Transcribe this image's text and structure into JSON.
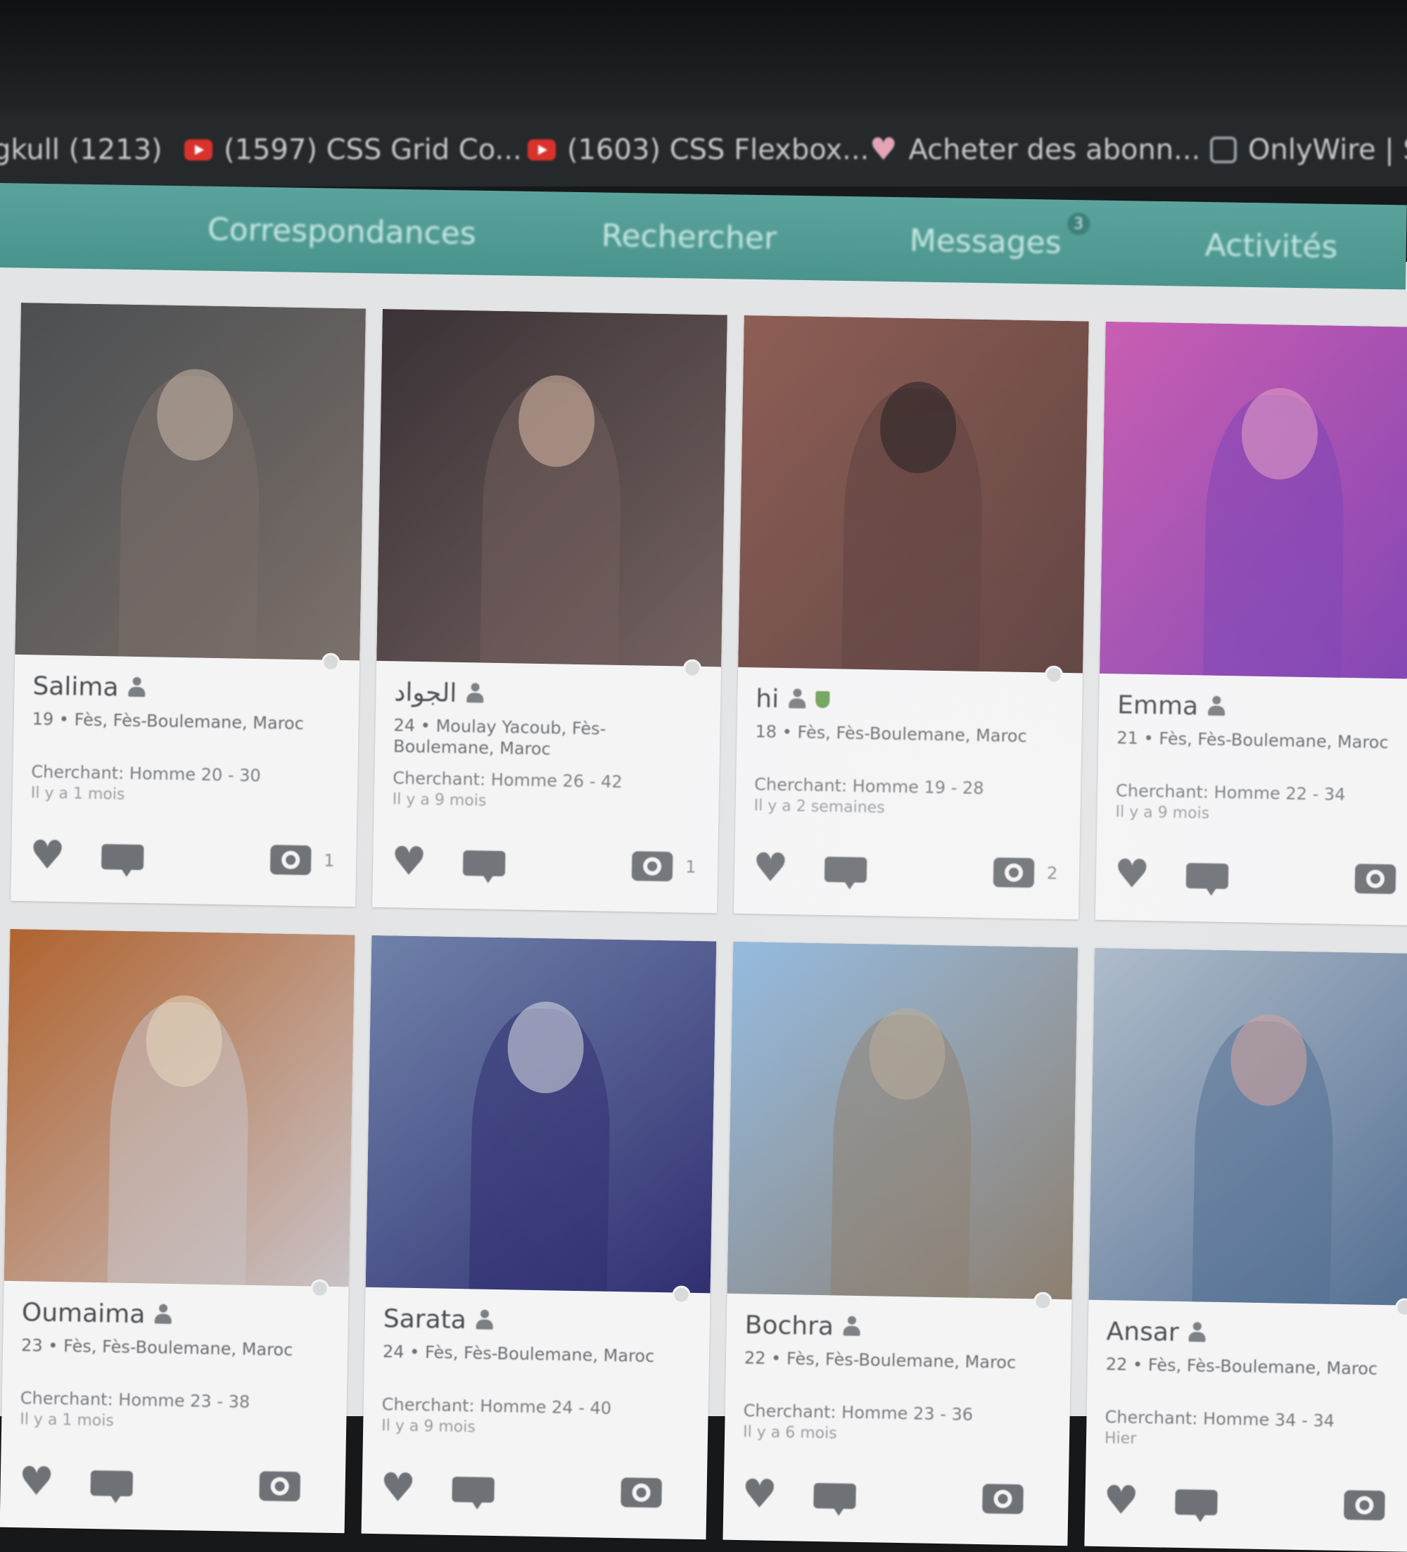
{
  "bookmarks": [
    {
      "label": "gkull (1213)",
      "icon": "bookmark-icon"
    },
    {
      "label": "(1597) CSS Grid Co...",
      "icon": "youtube-icon"
    },
    {
      "label": "(1603) CSS Flexbox...",
      "icon": "youtube-icon"
    },
    {
      "label": "Acheter des abonn...",
      "icon": "heart-icon"
    },
    {
      "label": "OnlyWire | S",
      "icon": "globe-icon"
    }
  ],
  "nav": {
    "items": [
      {
        "label": "Correspondances"
      },
      {
        "label": "Rechercher"
      },
      {
        "label": "Messages",
        "badge": "3"
      },
      {
        "label": "Activités"
      }
    ],
    "colors": {
      "bar": "#4f9a93",
      "text": "#c7e8e3"
    }
  },
  "profiles": [
    {
      "name": "Salima",
      "location": "19 • Fès, Fès-Boulemane, Maroc",
      "seeking": "Cherchant: Homme 20 - 30",
      "ago": "Il y a 1 mois",
      "photos": "1",
      "verified": false,
      "tones": [
        "#4b4f52",
        "#7a6e68",
        "#c9b7a8"
      ]
    },
    {
      "name": "الجواد",
      "location": "24 • Moulay Yacoub, Fès-Boulemane, Maroc",
      "seeking": "Cherchant: Homme 26 - 42",
      "ago": "Il y a 9 mois",
      "photos": "1",
      "verified": false,
      "tones": [
        "#3a3236",
        "#6d5a58",
        "#d8b8a6"
      ]
    },
    {
      "name": "hi",
      "location": "18 • Fès, Fès-Boulemane, Maroc",
      "seeking": "Cherchant: Homme 19 - 28",
      "ago": "Il y a 2 semaines",
      "photos": "2",
      "verified": true,
      "tones": [
        "#8c5b52",
        "#5a3c3a",
        "#1f1c1e"
      ]
    },
    {
      "name": "Emma",
      "location": "21 • Fès, Fès-Boulemane, Maroc",
      "seeking": "Cherchant: Homme 22 - 34",
      "ago": "Il y a 9 mois",
      "photos": "",
      "verified": false,
      "tones": [
        "#c85bb0",
        "#7c3fb2",
        "#e6a1c4"
      ]
    },
    {
      "name": "Oumaima",
      "location": "23 • Fès, Fès-Boulemane, Maroc",
      "seeking": "Cherchant: Homme 23 - 38",
      "ago": "Il y a 1 mois",
      "photos": "",
      "verified": false,
      "tones": [
        "#b0632f",
        "#c9c2c6",
        "#e8d8bd"
      ]
    },
    {
      "name": "Sarata",
      "location": "24 • Fès, Fès-Boulemane, Maroc",
      "seeking": "Cherchant: Homme 24 - 40",
      "ago": "Il y a 9 mois",
      "photos": "",
      "verified": false,
      "tones": [
        "#6c7fa8",
        "#2c2a6e",
        "#d9dfe3"
      ]
    },
    {
      "name": "Bochra",
      "location": "22 • Fès, Fès-Boulemane, Maroc",
      "seeking": "Cherchant: Homme 23 - 36",
      "ago": "Il y a 6 mois",
      "photos": "",
      "verified": false,
      "tones": [
        "#8fb7de",
        "#8a7b6b",
        "#b9a996"
      ]
    },
    {
      "name": "Ansar",
      "location": "22 • Fès, Fès-Boulemane, Maroc",
      "seeking": "Cherchant: Homme 34 - 34",
      "ago": "Hier",
      "photos": "",
      "verified": false,
      "tones": [
        "#a9b7c7",
        "#4f6b8f",
        "#d6a39a"
      ]
    }
  ]
}
